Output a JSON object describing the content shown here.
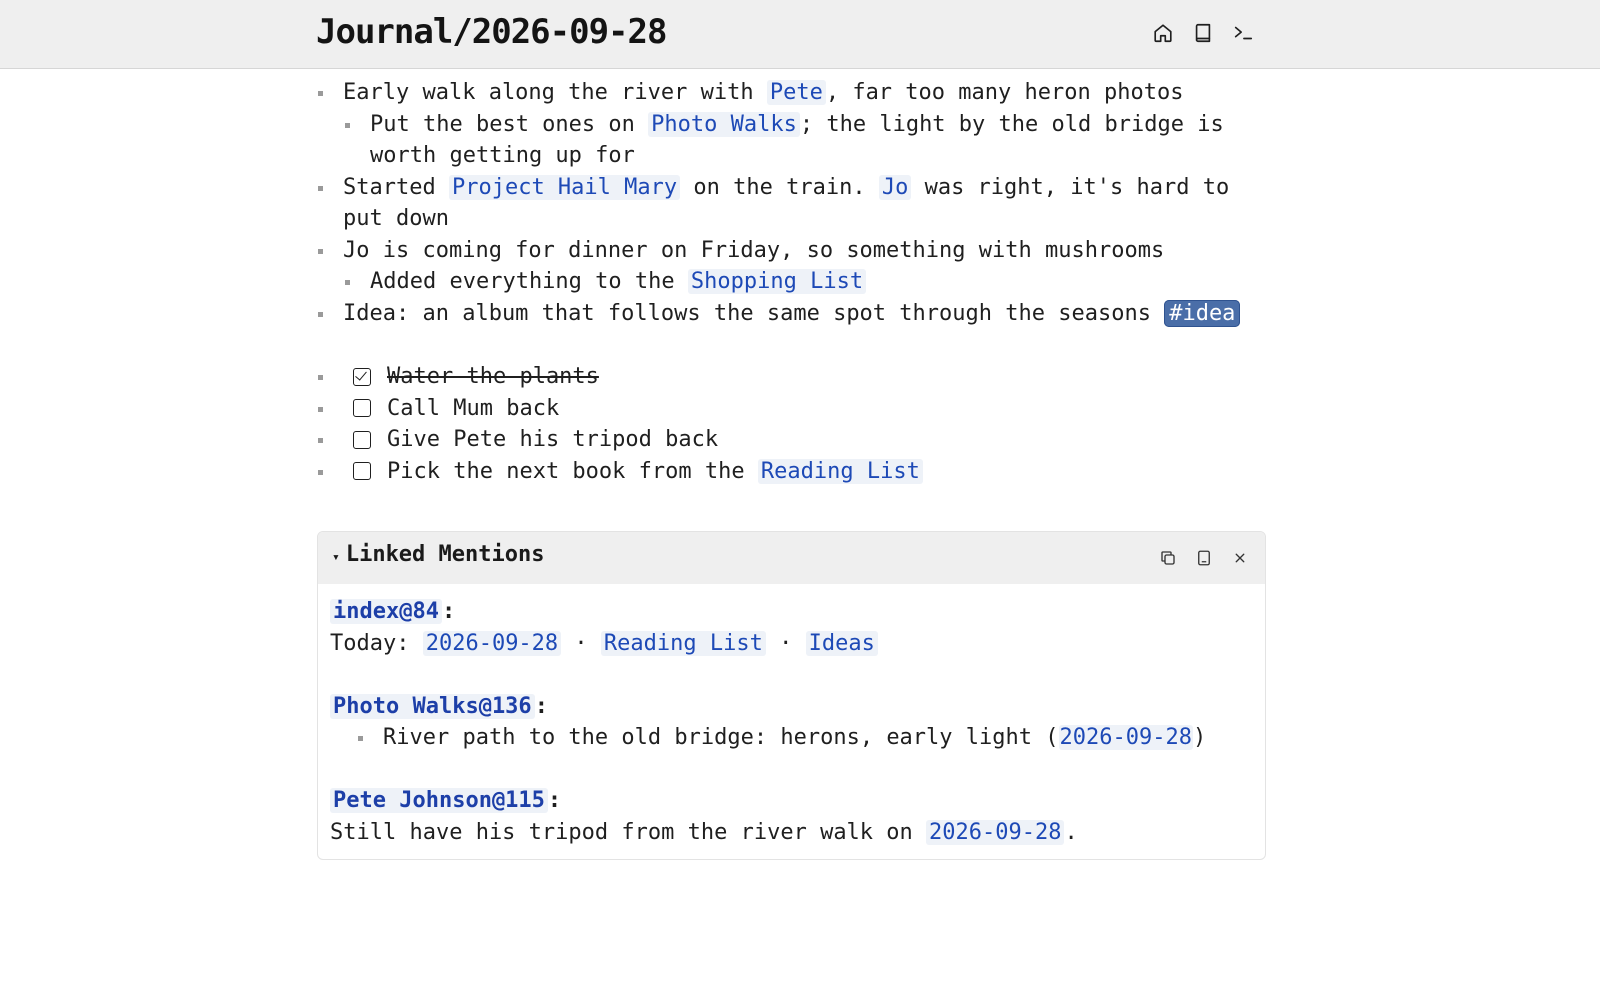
{
  "header": {
    "title": "Journal/2026-09-28",
    "icons": [
      "home-icon",
      "book-icon",
      "terminal-icon"
    ]
  },
  "journal": {
    "b1": {
      "t1": "Early walk along the river with ",
      "link1": "Pete",
      "t2": ", far too many heron photos"
    },
    "b1a": {
      "t1": "Put the best ones on ",
      "link1": "Photo Walks",
      "t2": "; the light by the old bridge is worth getting up for"
    },
    "b2": {
      "t1": "Started ",
      "link1": "Project Hail Mary",
      "t2": " on the train. ",
      "link2": "Jo",
      "t3": " was right, it's hard to put down"
    },
    "b3": {
      "t1": "Jo is coming for dinner on Friday, so something with mushrooms"
    },
    "b3a": {
      "t1": "Added everything to the ",
      "link1": "Shopping List"
    },
    "b4": {
      "t1": "Idea: an album that follows the same spot through the seasons ",
      "tag": "#idea"
    }
  },
  "todos": [
    {
      "text": "Water the plants",
      "checked": true
    },
    {
      "text": "Call Mum back",
      "checked": false
    },
    {
      "text": "Give Pete his tripod back",
      "checked": false
    },
    {
      "t1": "Pick the next book from the ",
      "link1": "Reading List",
      "checked": false
    }
  ],
  "mentions": {
    "title": "Linked Mentions",
    "toggle": "▾",
    "icons": [
      "copy-icon",
      "tablet-icon",
      "close-icon"
    ],
    "m1": {
      "source": "index@84",
      "colon": ":",
      "prefix": "Today: ",
      "link1": "2026-09-28",
      "sep": " · ",
      "link2": "Reading List",
      "link3": "Ideas"
    },
    "m2": {
      "source": "Photo Walks@136",
      "colon": ":",
      "t1": "River path to the old bridge: herons, early light (",
      "link1": "2026-09-28",
      "t2": ")"
    },
    "m3": {
      "source": "Pete Johnson@115",
      "colon": ":",
      "t1": "Still have his tripod from the river walk on ",
      "link1": "2026-09-28",
      "t2": "."
    }
  }
}
